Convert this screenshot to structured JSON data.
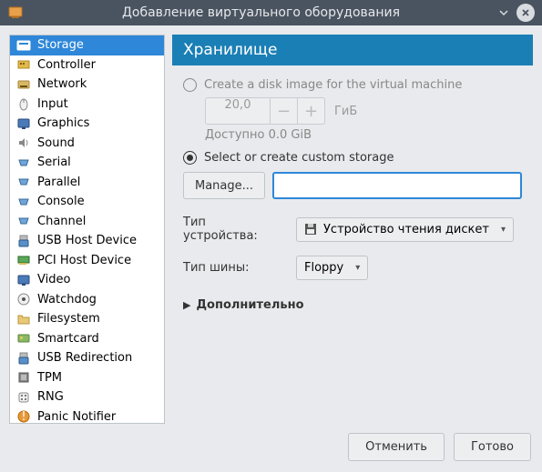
{
  "window": {
    "title": "Добавление виртуального оборудования"
  },
  "sidebar": {
    "items": [
      {
        "label": "Storage"
      },
      {
        "label": "Controller"
      },
      {
        "label": "Network"
      },
      {
        "label": "Input"
      },
      {
        "label": "Graphics"
      },
      {
        "label": "Sound"
      },
      {
        "label": "Serial"
      },
      {
        "label": "Parallel"
      },
      {
        "label": "Console"
      },
      {
        "label": "Channel"
      },
      {
        "label": "USB Host Device"
      },
      {
        "label": "PCI Host Device"
      },
      {
        "label": "Video"
      },
      {
        "label": "Watchdog"
      },
      {
        "label": "Filesystem"
      },
      {
        "label": "Smartcard"
      },
      {
        "label": "USB Redirection"
      },
      {
        "label": "TPM"
      },
      {
        "label": "RNG"
      },
      {
        "label": "Panic Notifier"
      }
    ]
  },
  "main": {
    "header": "Хранилище",
    "create_image_label": "Create a disk image for the virtual machine",
    "size_value": "20,0",
    "size_unit": "ГиБ",
    "available": "Доступно 0.0 GiB",
    "custom_storage_label": "Select or create custom storage",
    "manage_button": "Manage...",
    "path_value": "",
    "device_type_label": "Тип устройства:",
    "device_type_value": "Устройство чтения дискет",
    "bus_type_label": "Тип шины:",
    "bus_type_value": "Floppy",
    "advanced_label": "Дополнительно"
  },
  "footer": {
    "cancel": "Отменить",
    "ok": "Готово"
  }
}
